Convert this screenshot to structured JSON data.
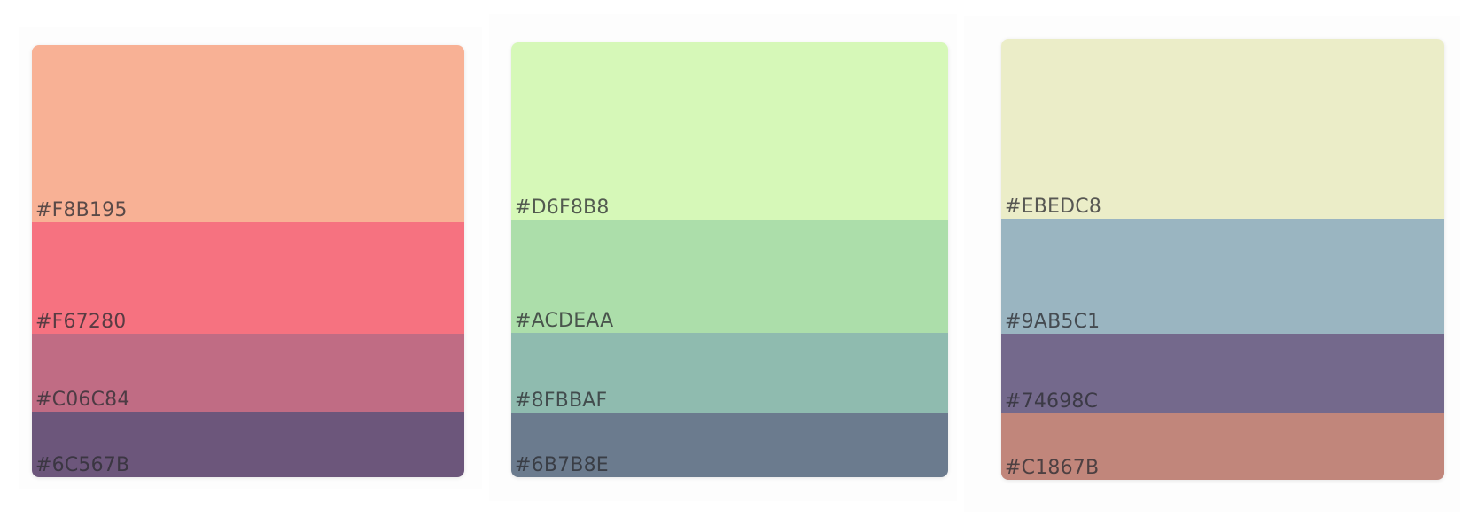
{
  "palettes": [
    {
      "swatches": [
        {
          "hex": "#F8B195",
          "label": "#F8B195"
        },
        {
          "hex": "#F67280",
          "label": "#F67280"
        },
        {
          "hex": "#C06C84",
          "label": "#C06C84"
        },
        {
          "hex": "#6C567B",
          "label": "#6C567B"
        }
      ]
    },
    {
      "swatches": [
        {
          "hex": "#D6F8B8",
          "label": "#D6F8B8"
        },
        {
          "hex": "#ACDEAA",
          "label": "#ACDEAA"
        },
        {
          "hex": "#8FBBAF",
          "label": "#8FBBAF"
        },
        {
          "hex": "#6B7B8E",
          "label": "#6B7B8E"
        }
      ]
    },
    {
      "swatches": [
        {
          "hex": "#EBEDC8",
          "label": "#EBEDC8"
        },
        {
          "hex": "#9AB5C1",
          "label": "#9AB5C1"
        },
        {
          "hex": "#74698C",
          "label": "#74698C"
        },
        {
          "hex": "#C1867B",
          "label": "#C1867B"
        }
      ]
    }
  ]
}
